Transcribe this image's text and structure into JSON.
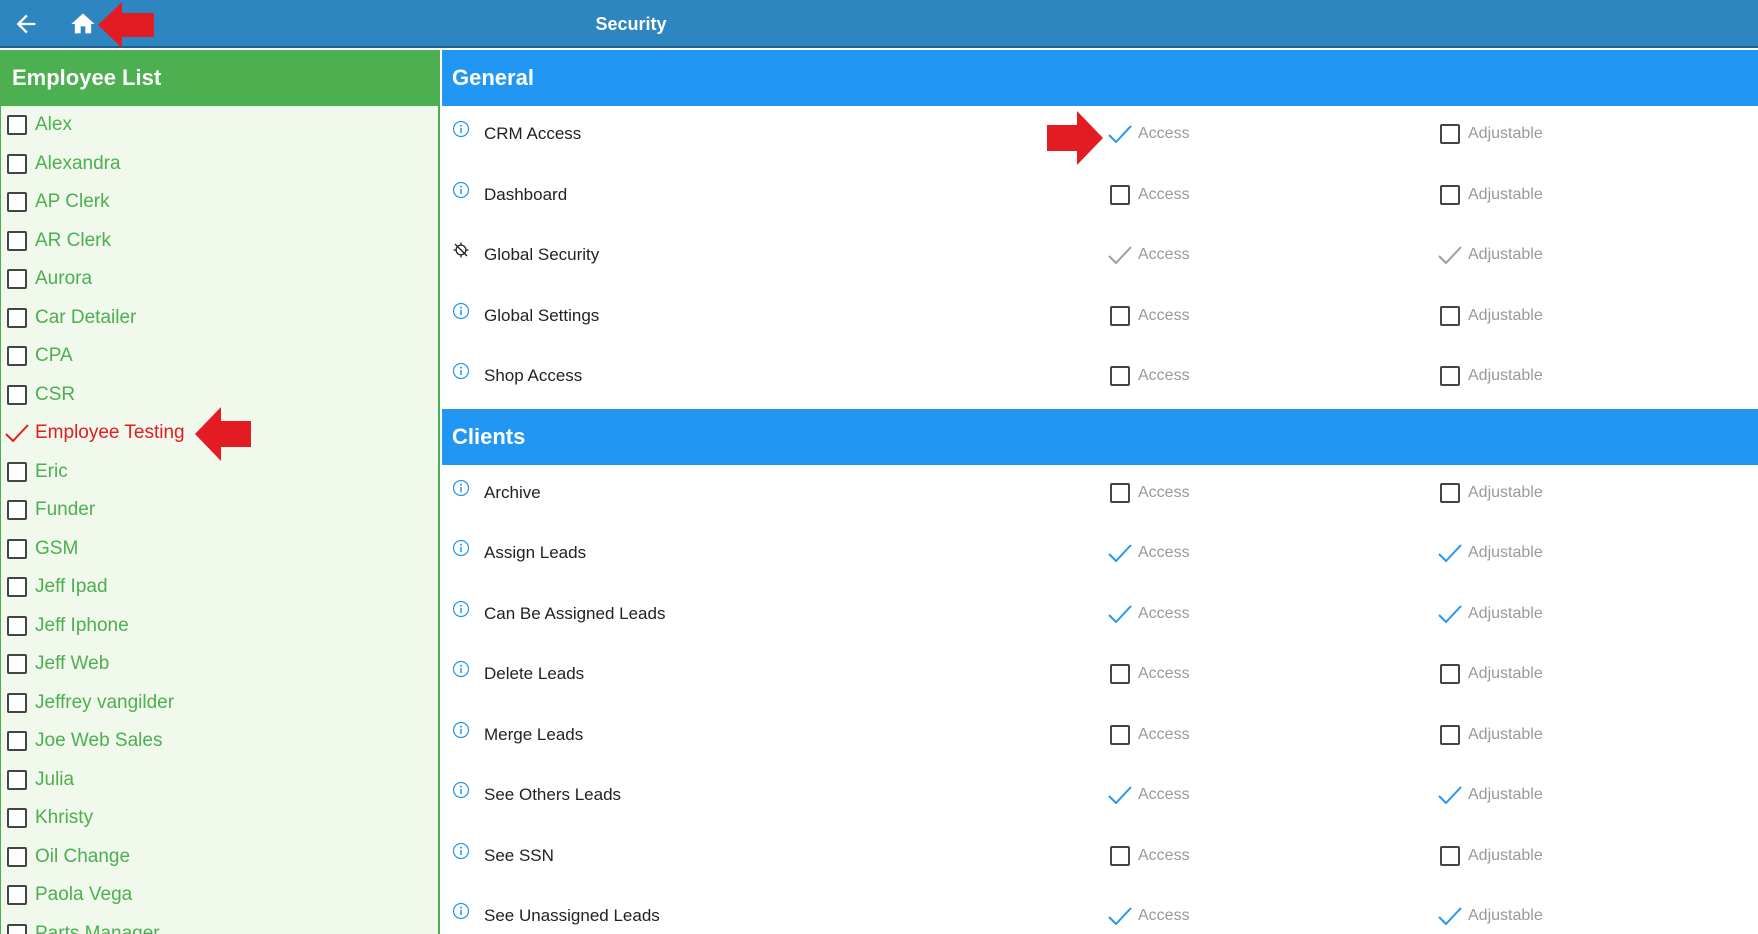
{
  "header": {
    "title": "Security"
  },
  "employee_list": {
    "title": "Employee List",
    "items": [
      {
        "label": "Alex",
        "checked": false
      },
      {
        "label": "Alexandra",
        "checked": false
      },
      {
        "label": "AP Clerk",
        "checked": false
      },
      {
        "label": "AR Clerk",
        "checked": false
      },
      {
        "label": "Aurora",
        "checked": false
      },
      {
        "label": "Car Detailer",
        "checked": false
      },
      {
        "label": "CPA",
        "checked": false
      },
      {
        "label": "CSR",
        "checked": false
      },
      {
        "label": "Employee Testing",
        "checked": true
      },
      {
        "label": "Eric",
        "checked": false
      },
      {
        "label": "Funder",
        "checked": false
      },
      {
        "label": "GSM",
        "checked": false
      },
      {
        "label": "Jeff Ipad",
        "checked": false
      },
      {
        "label": "Jeff Iphone",
        "checked": false
      },
      {
        "label": "Jeff Web",
        "checked": false
      },
      {
        "label": "Jeffrey vangilder",
        "checked": false
      },
      {
        "label": "Joe Web Sales",
        "checked": false
      },
      {
        "label": "Julia",
        "checked": false
      },
      {
        "label": "Khristy",
        "checked": false
      },
      {
        "label": "Oil Change",
        "checked": false
      },
      {
        "label": "Paola Vega",
        "checked": false
      },
      {
        "label": "Parts Manager",
        "checked": false
      }
    ]
  },
  "permissions": {
    "access_label": "Access",
    "adjustable_label": "Adjustable",
    "sections": [
      {
        "title": "General",
        "rows": [
          {
            "name": "CRM Access",
            "icon": "info-icon",
            "access": "checked",
            "adjustable": "unchecked"
          },
          {
            "name": "Dashboard",
            "icon": "info-icon",
            "access": "unchecked",
            "adjustable": "unchecked"
          },
          {
            "name": "Global Security",
            "icon": "crosshair-off-icon",
            "access": "checked-disabled",
            "adjustable": "checked-disabled"
          },
          {
            "name": "Global Settings",
            "icon": "info-icon",
            "access": "unchecked",
            "adjustable": "unchecked"
          },
          {
            "name": "Shop Access",
            "icon": "info-icon",
            "access": "unchecked",
            "adjustable": "unchecked"
          }
        ]
      },
      {
        "title": "Clients",
        "rows": [
          {
            "name": "Archive",
            "icon": "info-icon",
            "access": "unchecked",
            "adjustable": "unchecked"
          },
          {
            "name": "Assign Leads",
            "icon": "info-icon",
            "access": "checked",
            "adjustable": "checked"
          },
          {
            "name": "Can Be Assigned Leads",
            "icon": "info-icon",
            "access": "checked",
            "adjustable": "checked"
          },
          {
            "name": "Delete Leads",
            "icon": "info-icon",
            "access": "unchecked",
            "adjustable": "unchecked"
          },
          {
            "name": "Merge Leads",
            "icon": "info-icon",
            "access": "unchecked",
            "adjustable": "unchecked"
          },
          {
            "name": "See Others Leads",
            "icon": "info-icon",
            "access": "checked",
            "adjustable": "checked"
          },
          {
            "name": "See SSN",
            "icon": "info-icon",
            "access": "unchecked",
            "adjustable": "unchecked"
          },
          {
            "name": "See Unassigned Leads",
            "icon": "info-icon",
            "access": "checked",
            "adjustable": "checked"
          }
        ]
      }
    ]
  },
  "colors": {
    "topbar": "#2e86c1",
    "employee_header": "#4caf50",
    "employee_text": "#4caf50",
    "selected_employee": "#e31b23",
    "section_header": "#2196f3",
    "check_active": "#2196f3",
    "check_disabled": "#9e9e9e",
    "annotation_arrow": "#e31b23"
  }
}
